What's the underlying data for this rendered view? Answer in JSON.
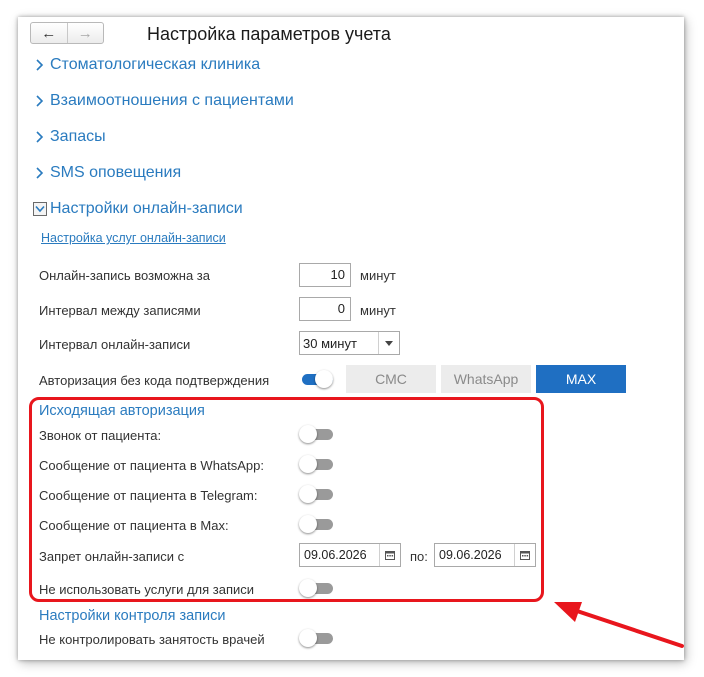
{
  "window": {
    "title": "Настройка параметров учета"
  },
  "nav": {
    "back": "←",
    "forward": "→"
  },
  "sections": {
    "clinic": "Стоматологическая клиника",
    "patients": "Взаимоотношения с пациентами",
    "stock": "Запасы",
    "sms": "SMS оповещения",
    "online": "Настройки онлайн-записи"
  },
  "online": {
    "services_link": "Настройка услуг онлайн-записи",
    "advance_label": "Онлайн-запись возможна за",
    "advance_value": "10",
    "advance_unit": "минут",
    "gap_label": "Интервал между записями",
    "gap_value": "0",
    "gap_unit": "минут",
    "interval_label": "Интервал онлайн-записи",
    "interval_value": "30 минут",
    "auth_label": "Авторизация без кода подтверждения",
    "auth_toggle_on": true,
    "channels": [
      "СМС",
      "WhatsApp",
      "MAX"
    ],
    "channel_selected": "MAX"
  },
  "outgoing": {
    "title": "Исходящая авторизация",
    "call_label": "Звонок от пациента:",
    "whatsapp_label": "Сообщение от пациента в WhatsApp:",
    "telegram_label": "Сообщение от пациента в Telegram:",
    "max_label": "Сообщение от пациента в Max:",
    "ban_label": "Запрет онлайн-записи с",
    "ban_from": "09.06.2026",
    "ban_to_label": "по:",
    "ban_to": "09.06.2026",
    "no_services_label": "Не использовать услуги для записи"
  },
  "control": {
    "title": "Настройки контроля записи",
    "doctors_label": "Не контролировать занятость врачей"
  },
  "colors": {
    "accent": "#1f6fc2",
    "link": "#2a7bbf",
    "highlight": "#e8161d"
  }
}
